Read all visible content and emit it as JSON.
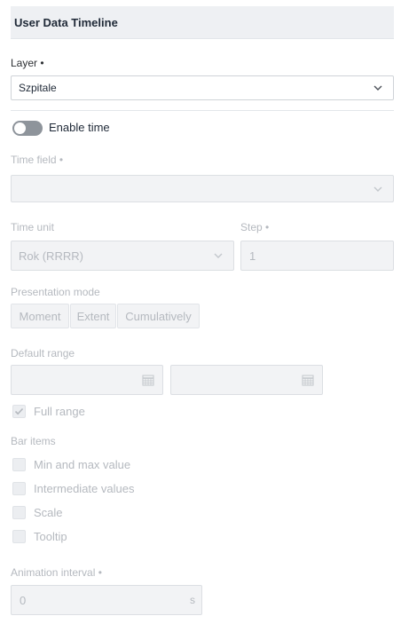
{
  "header": {
    "title": "User Data Timeline"
  },
  "layer": {
    "label": "Layer",
    "required_mark": "•",
    "value": "Szpitale"
  },
  "enable_time": {
    "label": "Enable time",
    "on": false
  },
  "time_field": {
    "label": "Time field",
    "required_mark": "•",
    "value": ""
  },
  "time_unit": {
    "label": "Time unit",
    "value": "Rok (RRRR)"
  },
  "step": {
    "label": "Step",
    "required_mark": "•",
    "value": "1"
  },
  "presentation_mode": {
    "label": "Presentation mode",
    "options": [
      "Moment",
      "Extent",
      "Cumulatively"
    ]
  },
  "default_range": {
    "label": "Default range",
    "start": "",
    "end": ""
  },
  "full_range": {
    "label": "Full range",
    "checked": true
  },
  "bar_items": {
    "label": "Bar items",
    "items": [
      {
        "label": "Min and max value",
        "checked": false
      },
      {
        "label": "Intermediate values",
        "checked": false
      },
      {
        "label": "Scale",
        "checked": false
      },
      {
        "label": "Tooltip",
        "checked": false
      }
    ]
  },
  "animation_interval": {
    "label": "Animation interval",
    "required_mark": "•",
    "value": "0",
    "unit": "s"
  },
  "colors": {
    "disabled_text": "#b5b9bf",
    "toggle_off": "#8e949b",
    "header_bg": "#eef0f3"
  },
  "icons": {
    "chevron": "chevron-down-icon",
    "calendar": "calendar-icon",
    "check": "check-icon"
  }
}
